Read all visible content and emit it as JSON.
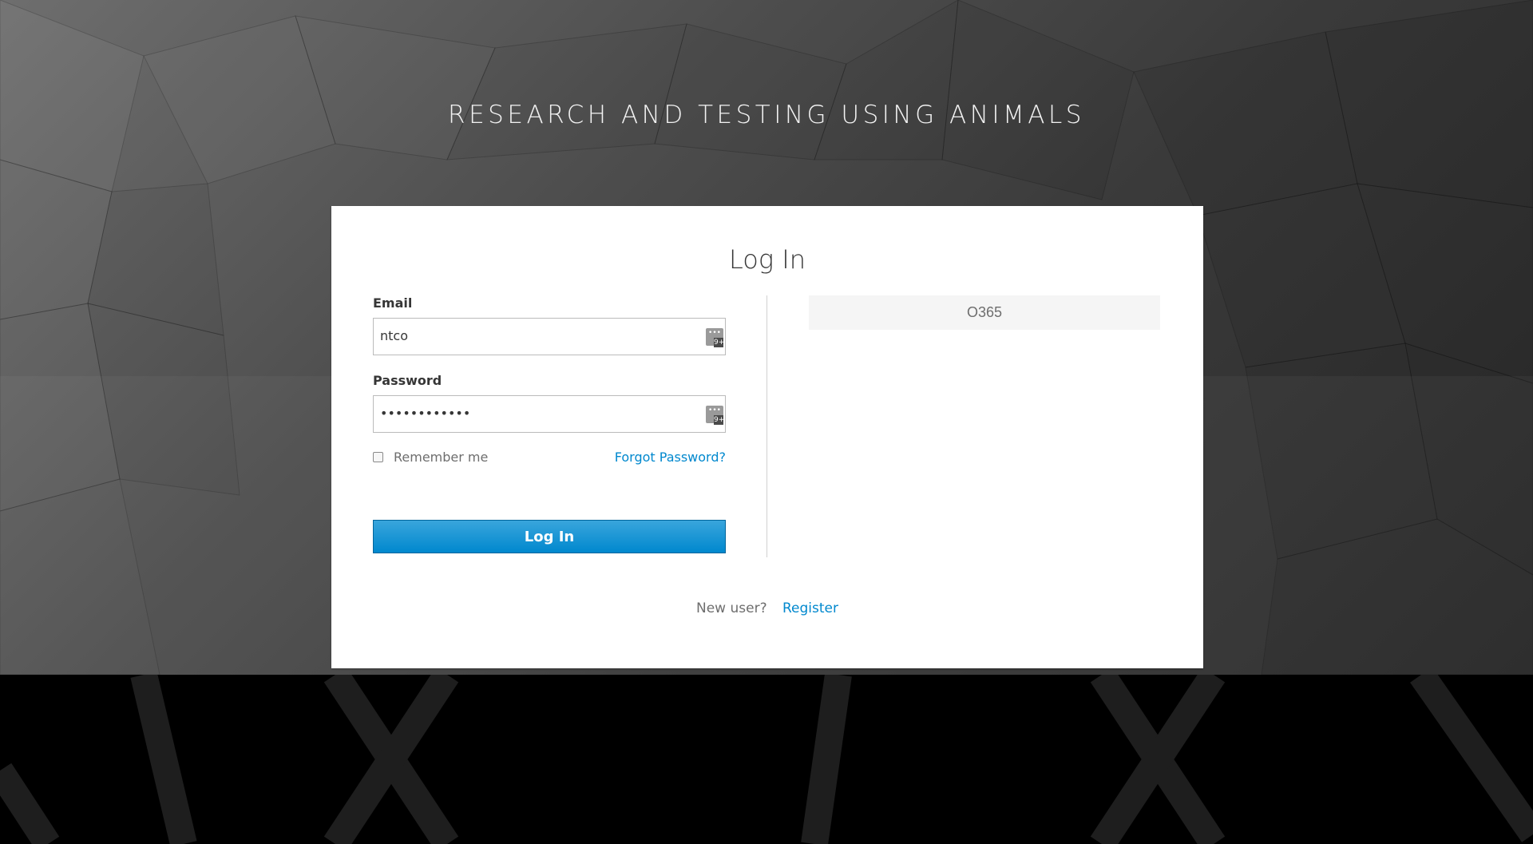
{
  "realm": {
    "title": "RESEARCH AND TESTING USING ANIMALS"
  },
  "login": {
    "heading": "Log In",
    "email_label": "Email",
    "email_value": "ntco",
    "password_label": "Password",
    "password_value": "••••••••••••",
    "remember_label": "Remember me",
    "remember_checked": false,
    "forgot_label": "Forgot Password?",
    "submit_label": "Log In"
  },
  "password_manager_icon": {
    "dots": "•••",
    "badge": "9+"
  },
  "social": {
    "providers": [
      {
        "label": "O365"
      }
    ]
  },
  "register": {
    "prompt": "New user?",
    "link_label": "Register"
  },
  "colors": {
    "accent": "#0088ce",
    "button_top": "#39a5dc",
    "button_bottom": "#0088ce",
    "card_bg": "#ffffff",
    "social_bg": "#f5f5f5"
  },
  "icons": [
    "password-manager-icon",
    "checkbox"
  ]
}
